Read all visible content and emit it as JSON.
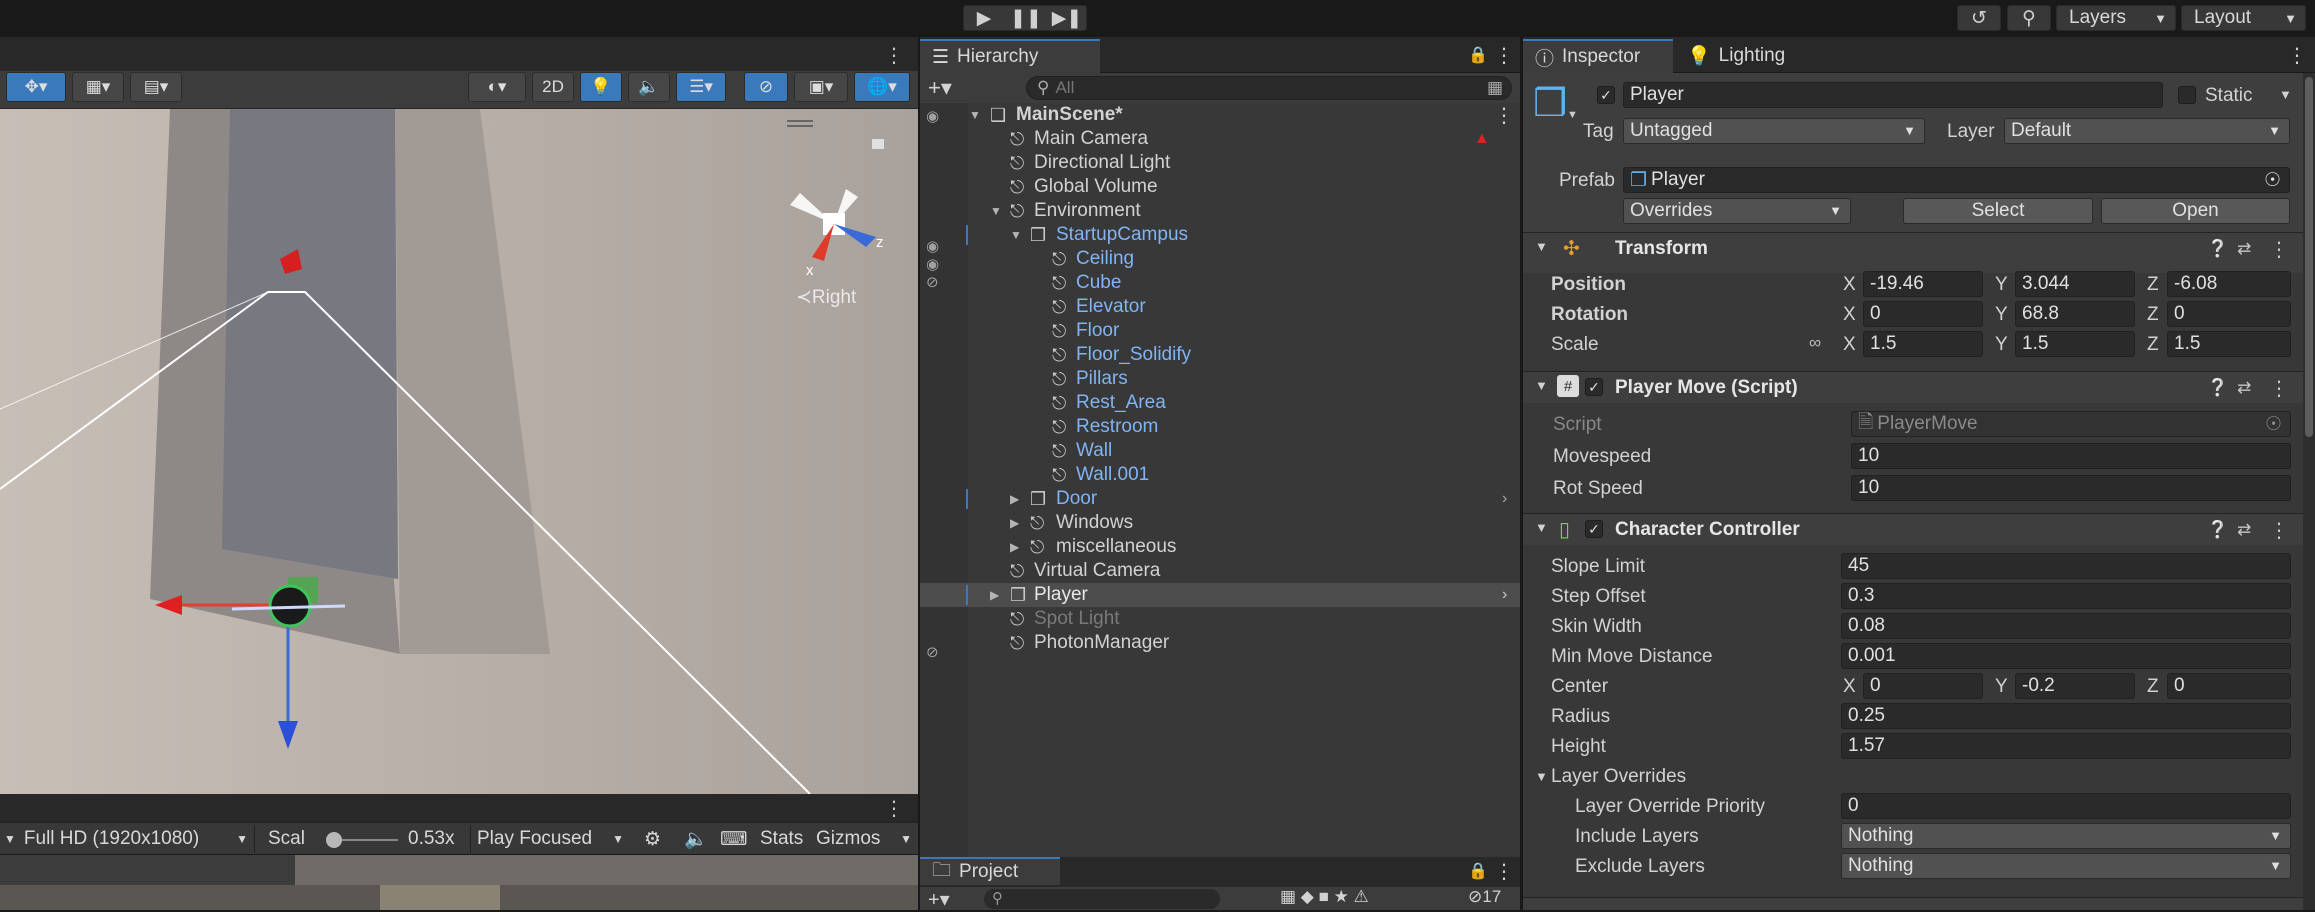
{
  "toolbar": {
    "play_icon": "play-icon",
    "pause_icon": "pause-icon",
    "step_icon": "step-icon",
    "layers": "Layers",
    "layout": "Layout"
  },
  "scene": {
    "toggle_2d": "2D",
    "gizmo_axes": {
      "x": "x",
      "z": "z"
    },
    "gizmo_view": "Right"
  },
  "game": {
    "resolution": "Full HD (1920x1080)",
    "scale_label": "Scal",
    "scale_value": "0.53x",
    "play_mode": "Play Focused",
    "stats": "Stats",
    "gizmos": "Gizmos"
  },
  "hierarchy": {
    "tab": "Hierarchy",
    "search_placeholder": "All",
    "scene_name": "MainScene*",
    "items": [
      {
        "label": "Main Camera"
      },
      {
        "label": "Directional Light"
      },
      {
        "label": "Global Volume"
      },
      {
        "label": "Environment"
      },
      {
        "label": "StartupCampus"
      },
      {
        "label": "Ceiling"
      },
      {
        "label": "Cube"
      },
      {
        "label": "Elevator"
      },
      {
        "label": "Floor"
      },
      {
        "label": "Floor_Solidify"
      },
      {
        "label": "Pillars"
      },
      {
        "label": "Rest_Area"
      },
      {
        "label": "Restroom"
      },
      {
        "label": "Wall"
      },
      {
        "label": "Wall.001"
      },
      {
        "label": "Door"
      },
      {
        "label": "Windows"
      },
      {
        "label": "miscellaneous"
      },
      {
        "label": "Virtual Camera"
      },
      {
        "label": "Player"
      },
      {
        "label": "Spot Light"
      },
      {
        "label": "PhotonManager"
      }
    ]
  },
  "project": {
    "tab": "Project",
    "hidden_count": "17"
  },
  "inspector": {
    "tabs": [
      "Inspector",
      "Lighting"
    ],
    "object_name": "Player",
    "static_label": "Static",
    "tag_label": "Tag",
    "tag_value": "Untagged",
    "layer_label": "Layer",
    "layer_value": "Default",
    "prefab_label": "Prefab",
    "prefab_value": "Player",
    "overrides": "Overrides",
    "select": "Select",
    "open": "Open",
    "transform": {
      "title": "Transform",
      "position_label": "Position",
      "position": {
        "x": "-19.46",
        "y": "3.044",
        "z": "-6.08"
      },
      "rotation_label": "Rotation",
      "rotation": {
        "x": "0",
        "y": "68.8",
        "z": "0"
      },
      "scale_label": "Scale",
      "scale": {
        "x": "1.5",
        "y": "1.5",
        "z": "1.5"
      }
    },
    "player_move": {
      "title": "Player Move (Script)",
      "script_label": "Script",
      "script_value": "PlayerMove",
      "movespeed_label": "Movespeed",
      "movespeed": "10",
      "rotspeed_label": "Rot Speed",
      "rotspeed": "10"
    },
    "character_controller": {
      "title": "Character Controller",
      "slope_limit_label": "Slope Limit",
      "slope_limit": "45",
      "step_offset_label": "Step Offset",
      "step_offset": "0.3",
      "skin_width_label": "Skin Width",
      "skin_width": "0.08",
      "min_move_label": "Min Move Distance",
      "min_move": "0.001",
      "center_label": "Center",
      "center": {
        "x": "0",
        "y": "-0.2",
        "z": "0"
      },
      "radius_label": "Radius",
      "radius": "0.25",
      "height_label": "Height",
      "height": "1.57",
      "layer_overrides_label": "Layer Overrides",
      "priority_label": "Layer Override Priority",
      "priority": "0",
      "include_label": "Include Layers",
      "include": "Nothing",
      "exclude_label": "Exclude Layers",
      "exclude": "Nothing"
    },
    "axis": {
      "x": "X",
      "y": "Y",
      "z": "Z"
    }
  }
}
